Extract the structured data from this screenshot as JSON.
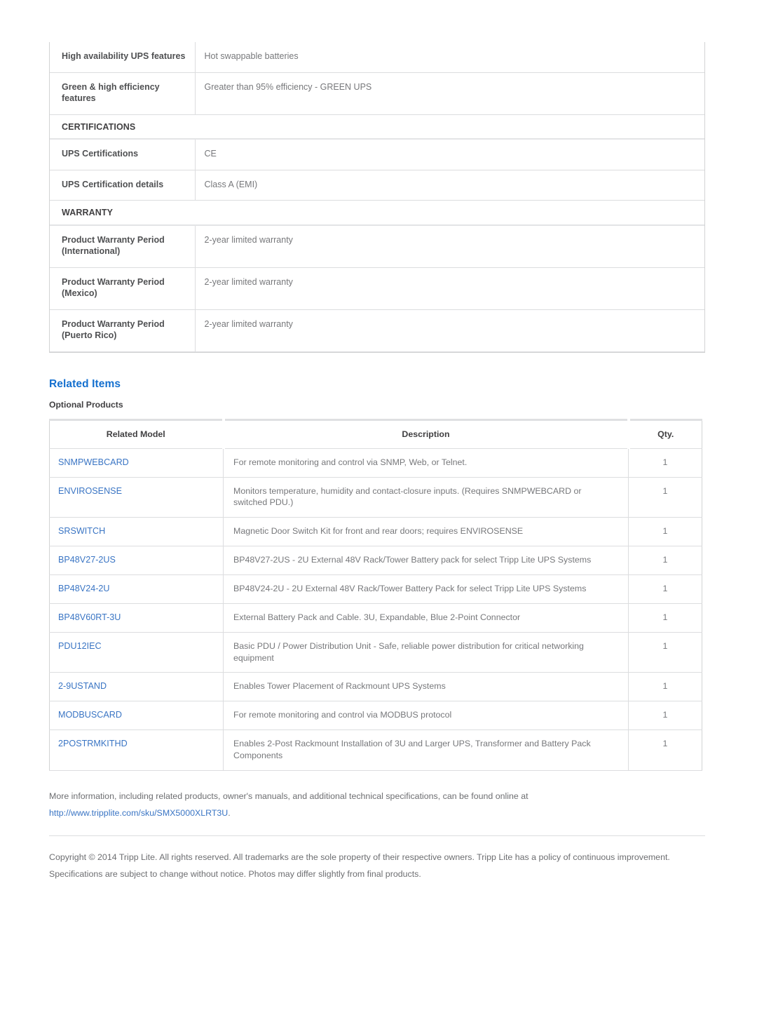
{
  "spec_table": {
    "rows": [
      {
        "type": "data",
        "label": "High availability UPS features",
        "value": "Hot swappable batteries"
      },
      {
        "type": "data",
        "label": "Green & high efficiency features",
        "value": "Greater than 95% efficiency - GREEN UPS"
      },
      {
        "type": "section",
        "label": "CERTIFICATIONS"
      },
      {
        "type": "data",
        "label": "UPS Certifications",
        "value": "CE"
      },
      {
        "type": "data",
        "label": "UPS Certification details",
        "value": "Class A (EMI)"
      },
      {
        "type": "section",
        "label": "WARRANTY"
      },
      {
        "type": "data",
        "label": "Product Warranty Period (International)",
        "value": "2-year limited warranty"
      },
      {
        "type": "data",
        "label": "Product Warranty Period (Mexico)",
        "value": "2-year limited warranty"
      },
      {
        "type": "data",
        "label": "Product Warranty Period (Puerto Rico)",
        "value": "2-year limited warranty"
      }
    ]
  },
  "related_items": {
    "title": "Related Items",
    "subtitle": "Optional Products",
    "columns": [
      "Related Model",
      "Description",
      "Qty."
    ],
    "rows": [
      {
        "model": "SNMPWEBCARD",
        "description": "For remote monitoring and control via SNMP, Web, or Telnet.",
        "qty": "1"
      },
      {
        "model": "ENVIROSENSE",
        "description": "Monitors temperature, humidity and contact-closure inputs. (Requires SNMPWEBCARD or switched PDU.)",
        "qty": "1"
      },
      {
        "model": "SRSWITCH",
        "description": "Magnetic Door Switch Kit for front and rear doors; requires ENVIROSENSE",
        "qty": "1"
      },
      {
        "model": "BP48V27-2US",
        "description": "BP48V27-2US - 2U External 48V Rack/Tower Battery pack for select Tripp Lite UPS Systems",
        "qty": "1"
      },
      {
        "model": "BP48V24-2U",
        "description": "BP48V24-2U - 2U External 48V Rack/Tower Battery Pack for select Tripp Lite UPS Systems",
        "qty": "1"
      },
      {
        "model": "BP48V60RT-3U",
        "description": "External Battery Pack and Cable. 3U, Expandable, Blue 2-Point Connector",
        "qty": "1"
      },
      {
        "model": "PDU12IEC",
        "description": "Basic PDU / Power Distribution Unit - Safe, reliable power distribution for critical networking equipment",
        "qty": "1"
      },
      {
        "model": "2-9USTAND",
        "description": "Enables Tower Placement of Rackmount UPS Systems",
        "qty": "1"
      },
      {
        "model": "MODBUSCARD",
        "description": "For remote monitoring and control via MODBUS protocol",
        "qty": "1"
      },
      {
        "model": "2POSTRMKITHD",
        "description": "Enables 2-Post Rackmount Installation of 3U and Larger UPS, Transformer and Battery Pack Components",
        "qty": "1"
      }
    ]
  },
  "footer": {
    "more_info_text": "More information, including related products, owner's manuals, and additional technical specifications, can be found online at",
    "more_info_link": "http://www.tripplite.com/sku/SMX5000XLRT3U",
    "more_info_link_suffix": ".",
    "copyright": "Copyright © 2014 Tripp Lite. All rights reserved. All trademarks are the sole property of their respective owners. Tripp Lite has a policy of continuous improvement. Specifications are subject to change without notice. Photos may differ slightly from final products."
  },
  "colors": {
    "heading_blue": "#1570cf",
    "link_blue": "#3a75c4",
    "label_gray": "#4f5052",
    "value_gray": "#77787b",
    "border_gray": "#dcdddf"
  }
}
